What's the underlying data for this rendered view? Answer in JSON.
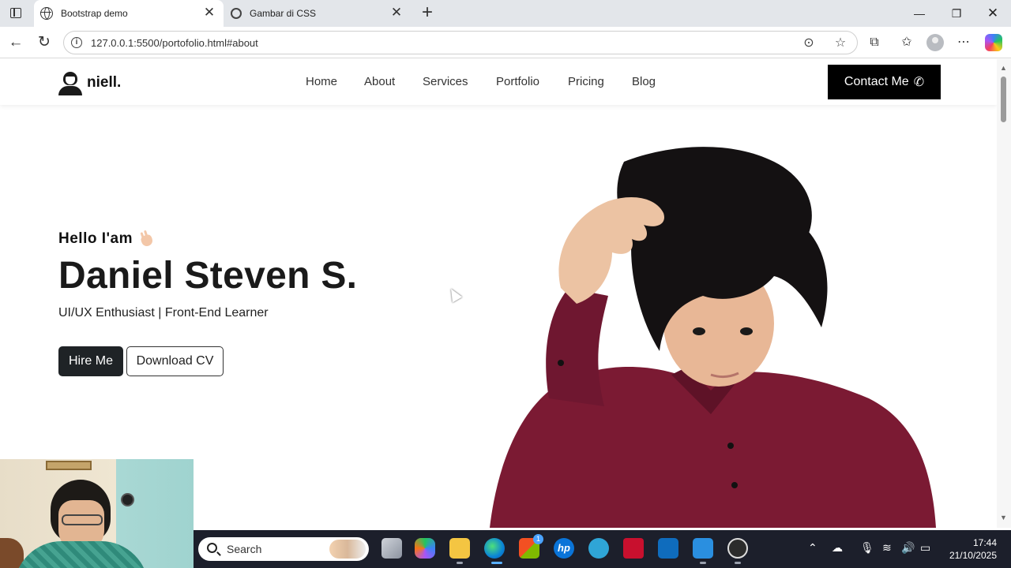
{
  "browser": {
    "tabs": [
      {
        "title": "Bootstrap demo",
        "active": true,
        "icon": "globe-icon"
      },
      {
        "title": "Gambar di CSS",
        "active": false,
        "icon": "chatgpt-icon"
      }
    ],
    "url": "127.0.0.1:5500/portofolio.html#about"
  },
  "site": {
    "brand": "niell.",
    "nav": [
      "Home",
      "About",
      "Services",
      "Portfolio",
      "Pricing",
      "Blog"
    ],
    "contact_label": "Contact Me",
    "hero": {
      "greeting": "Hello I'am",
      "name": "Daniel Steven S.",
      "tagline": "UI/UX Enthusiast | Front-End Learner",
      "hire_label": "Hire Me",
      "cv_label": "Download CV"
    }
  },
  "taskbar": {
    "search_placeholder": "Search",
    "time": "17:44",
    "date": "21/10/2025",
    "store_badge": "1"
  },
  "colors": {
    "shirt": "#7b1a33",
    "hair": "#141112",
    "skin": "#e8b796",
    "taskbar": "#1c1f2b"
  }
}
